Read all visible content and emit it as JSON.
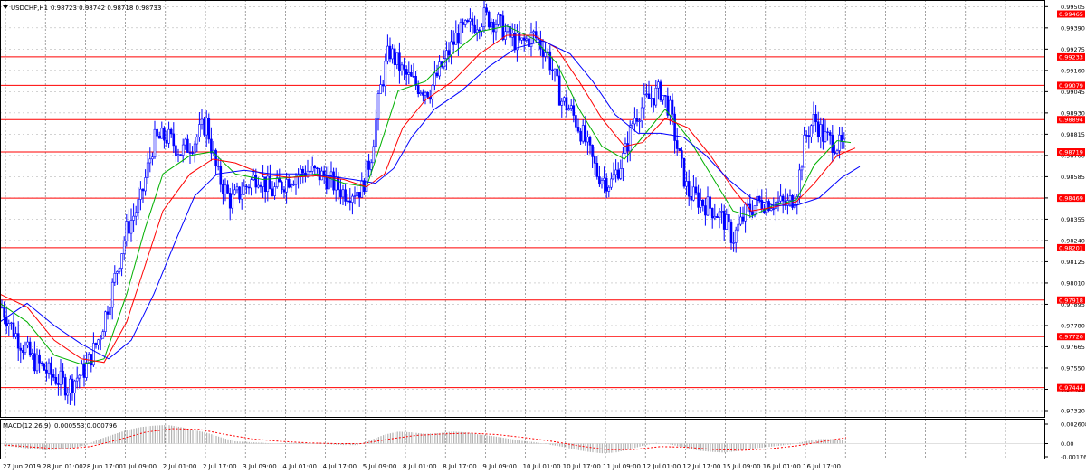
{
  "window": {
    "symbol_label": "USDCHF,H1",
    "ohlc_text": "0.98723 0.98742 0.98718 0.98733",
    "collapse_icon": "triangle-down-icon"
  },
  "macd_panel": {
    "label": "MACD(12,26,9)",
    "values_text": "0.000553 0.000796",
    "axis_ticks": [
      "0.002608",
      "0.00",
      "-0.001761"
    ],
    "ylim": [
      -0.001761,
      0.002608
    ]
  },
  "colors": {
    "candles": "#0000ff",
    "support_resistance_lines": "#ff0000",
    "ma_fast": "#00b000",
    "ma_mid": "#ff0000",
    "ma_slow": "#0000ff",
    "macd_histogram": "#b4b4b4",
    "macd_signal": "#ff0000",
    "level_tag_bg": "#ff0000"
  },
  "chart_data": {
    "type": "candlestick",
    "title": "",
    "ylim": [
      0.9732,
      0.9958
    ],
    "grid": true,
    "price_axis_ticks": [
      "0.99505",
      "0.99390",
      "0.99275",
      "0.99160",
      "0.99045",
      "0.98930",
      "0.98815",
      "0.98700",
      "0.98585",
      "0.98470",
      "0.98355",
      "0.98240",
      "0.98125",
      "0.98010",
      "0.97895",
      "0.97780",
      "0.97665",
      "0.97550",
      "0.97435",
      "0.97320"
    ],
    "time_axis_labels": [
      "27 Jun 2019",
      "28 Jun 01:00",
      "28 Jun 17:00",
      "1 Jul 09:00",
      "2 Jul 01:00",
      "2 Jul 17:00",
      "3 Jul 09:00",
      "4 Jul 01:00",
      "4 Jul 17:00",
      "5 Jul 09:00",
      "8 Jul 01:00",
      "8 Jul 17:00",
      "9 Jul 09:00",
      "10 Jul 01:00",
      "10 Jul 17:00",
      "11 Jul 09:00",
      "12 Jul 01:00",
      "12 Jul 17:00",
      "15 Jul 09:00",
      "16 Jul 01:00",
      "16 Jul 17:00"
    ],
    "horizontal_levels": [
      "0.99465",
      "0.99233",
      "0.99079",
      "0.98894",
      "0.98719",
      "0.98469",
      "0.98201",
      "0.97918",
      "0.97720",
      "0.97444"
    ],
    "price_path": [
      [
        0,
        0.979
      ],
      [
        15,
        0.9775
      ],
      [
        35,
        0.976
      ],
      [
        55,
        0.9752
      ],
      [
        75,
        0.9745
      ],
      [
        95,
        0.9755
      ],
      [
        110,
        0.9772
      ],
      [
        125,
        0.98
      ],
      [
        140,
        0.983
      ],
      [
        155,
        0.9845
      ],
      [
        170,
        0.9878
      ],
      [
        185,
        0.988
      ],
      [
        200,
        0.9872
      ],
      [
        215,
        0.9878
      ],
      [
        228,
        0.9888
      ],
      [
        240,
        0.986
      ],
      [
        255,
        0.9845
      ],
      [
        270,
        0.9852
      ],
      [
        285,
        0.986
      ],
      [
        300,
        0.985
      ],
      [
        320,
        0.9858
      ],
      [
        340,
        0.9862
      ],
      [
        360,
        0.9858
      ],
      [
        380,
        0.985
      ],
      [
        400,
        0.9852
      ],
      [
        410,
        0.987
      ],
      [
        420,
        0.9905
      ],
      [
        430,
        0.9927
      ],
      [
        445,
        0.9915
      ],
      [
        460,
        0.9908
      ],
      [
        475,
        0.9905
      ],
      [
        490,
        0.992
      ],
      [
        505,
        0.9935
      ],
      [
        520,
        0.994
      ],
      [
        535,
        0.9945
      ],
      [
        550,
        0.9942
      ],
      [
        560,
        0.9935
      ],
      [
        575,
        0.993
      ],
      [
        590,
        0.9935
      ],
      [
        605,
        0.9925
      ],
      [
        620,
        0.99
      ],
      [
        630,
        0.9895
      ],
      [
        645,
        0.988
      ],
      [
        660,
        0.986
      ],
      [
        675,
        0.9855
      ],
      [
        690,
        0.987
      ],
      [
        700,
        0.989
      ],
      [
        715,
        0.99
      ],
      [
        730,
        0.9905
      ],
      [
        740,
        0.9895
      ],
      [
        750,
        0.987
      ],
      [
        760,
        0.985
      ],
      [
        775,
        0.9845
      ],
      [
        790,
        0.984
      ],
      [
        800,
        0.9835
      ],
      [
        810,
        0.9825
      ],
      [
        825,
        0.984
      ],
      [
        840,
        0.9845
      ],
      [
        855,
        0.9845
      ],
      [
        870,
        0.9843
      ],
      [
        880,
        0.985
      ],
      [
        890,
        0.988
      ],
      [
        900,
        0.989
      ],
      [
        910,
        0.988
      ],
      [
        925,
        0.9876
      ],
      [
        935,
        0.9873
      ]
    ],
    "moving_averages": [
      {
        "name": "",
        "color": "#00b000",
        "points": [
          [
            0,
            0.979
          ],
          [
            30,
            0.978
          ],
          [
            60,
            0.9762
          ],
          [
            90,
            0.9757
          ],
          [
            115,
            0.976
          ],
          [
            140,
            0.9795
          ],
          [
            160,
            0.983
          ],
          [
            180,
            0.986
          ],
          [
            210,
            0.987
          ],
          [
            235,
            0.9872
          ],
          [
            260,
            0.986
          ],
          [
            290,
            0.9857
          ],
          [
            320,
            0.9858
          ],
          [
            350,
            0.986
          ],
          [
            380,
            0.9855
          ],
          [
            405,
            0.9853
          ],
          [
            420,
            0.9875
          ],
          [
            440,
            0.9905
          ],
          [
            470,
            0.991
          ],
          [
            500,
            0.9925
          ],
          [
            530,
            0.9937
          ],
          [
            560,
            0.994
          ],
          [
            590,
            0.9933
          ],
          [
            615,
            0.992
          ],
          [
            640,
            0.9895
          ],
          [
            665,
            0.9875
          ],
          [
            690,
            0.9868
          ],
          [
            710,
            0.988
          ],
          [
            735,
            0.9895
          ],
          [
            760,
            0.988
          ],
          [
            785,
            0.986
          ],
          [
            810,
            0.984
          ],
          [
            830,
            0.9837
          ],
          [
            855,
            0.9843
          ],
          [
            880,
            0.9846
          ],
          [
            900,
            0.9865
          ],
          [
            925,
            0.9878
          ],
          [
            940,
            0.9877
          ]
        ]
      },
      {
        "name": "",
        "color": "#ff0000",
        "points": [
          [
            0,
            0.9795
          ],
          [
            30,
            0.9788
          ],
          [
            60,
            0.977
          ],
          [
            90,
            0.976
          ],
          [
            115,
            0.9758
          ],
          [
            140,
            0.978
          ],
          [
            160,
            0.981
          ],
          [
            180,
            0.984
          ],
          [
            210,
            0.986
          ],
          [
            235,
            0.9868
          ],
          [
            260,
            0.9866
          ],
          [
            290,
            0.986
          ],
          [
            320,
            0.9858
          ],
          [
            350,
            0.9859
          ],
          [
            380,
            0.9857
          ],
          [
            405,
            0.9853
          ],
          [
            425,
            0.986
          ],
          [
            445,
            0.9885
          ],
          [
            470,
            0.99
          ],
          [
            500,
            0.991
          ],
          [
            530,
            0.9925
          ],
          [
            560,
            0.9935
          ],
          [
            590,
            0.9935
          ],
          [
            615,
            0.9928
          ],
          [
            640,
            0.991
          ],
          [
            665,
            0.989
          ],
          [
            690,
            0.9875
          ],
          [
            710,
            0.9877
          ],
          [
            735,
            0.989
          ],
          [
            760,
            0.9885
          ],
          [
            785,
            0.987
          ],
          [
            810,
            0.9852
          ],
          [
            830,
            0.984
          ],
          [
            855,
            0.9842
          ],
          [
            880,
            0.9845
          ],
          [
            900,
            0.9855
          ],
          [
            925,
            0.987
          ],
          [
            945,
            0.9874
          ]
        ]
      },
      {
        "name": "",
        "color": "#0000ff",
        "points": [
          [
            0,
            0.978
          ],
          [
            30,
            0.979
          ],
          [
            60,
            0.9778
          ],
          [
            90,
            0.9768
          ],
          [
            120,
            0.976
          ],
          [
            145,
            0.977
          ],
          [
            170,
            0.9795
          ],
          [
            195,
            0.9825
          ],
          [
            215,
            0.9848
          ],
          [
            240,
            0.986
          ],
          [
            270,
            0.9862
          ],
          [
            300,
            0.986
          ],
          [
            330,
            0.986
          ],
          [
            360,
            0.9859
          ],
          [
            390,
            0.9857
          ],
          [
            415,
            0.9855
          ],
          [
            435,
            0.9863
          ],
          [
            455,
            0.988
          ],
          [
            480,
            0.9895
          ],
          [
            510,
            0.9905
          ],
          [
            540,
            0.9918
          ],
          [
            570,
            0.9928
          ],
          [
            600,
            0.9932
          ],
          [
            630,
            0.9925
          ],
          [
            655,
            0.991
          ],
          [
            680,
            0.9892
          ],
          [
            705,
            0.9882
          ],
          [
            730,
            0.9882
          ],
          [
            755,
            0.988
          ],
          [
            780,
            0.987
          ],
          [
            805,
            0.9857
          ],
          [
            830,
            0.9847
          ],
          [
            855,
            0.9843
          ],
          [
            880,
            0.9843
          ],
          [
            905,
            0.9847
          ],
          [
            930,
            0.9858
          ],
          [
            950,
            0.9864
          ]
        ]
      }
    ],
    "macd_histogram": [
      [
        5,
        -0.0003
      ],
      [
        20,
        -0.0005
      ],
      [
        35,
        -0.0007
      ],
      [
        50,
        -0.0009
      ],
      [
        65,
        -0.0008
      ],
      [
        80,
        -0.0006
      ],
      [
        95,
        -0.0002
      ],
      [
        110,
        0.0006
      ],
      [
        125,
        0.0012
      ],
      [
        140,
        0.0018
      ],
      [
        155,
        0.0022
      ],
      [
        170,
        0.0024
      ],
      [
        185,
        0.0025
      ],
      [
        200,
        0.0022
      ],
      [
        215,
        0.0018
      ],
      [
        230,
        0.0014
      ],
      [
        245,
        0.0008
      ],
      [
        260,
        0.0003
      ],
      [
        275,
        0.0002
      ],
      [
        290,
        0.0001
      ],
      [
        305,
        0.0
      ],
      [
        320,
        0.0001
      ],
      [
        335,
        0.0001
      ],
      [
        350,
        0.0
      ],
      [
        365,
        -0.0001
      ],
      [
        380,
        -0.0002
      ],
      [
        395,
        -0.0002
      ],
      [
        410,
        0.0005
      ],
      [
        425,
        0.0012
      ],
      [
        440,
        0.0016
      ],
      [
        455,
        0.0015
      ],
      [
        470,
        0.0013
      ],
      [
        485,
        0.0014
      ],
      [
        500,
        0.0016
      ],
      [
        515,
        0.0015
      ],
      [
        530,
        0.0012
      ],
      [
        545,
        0.001
      ],
      [
        560,
        0.0007
      ],
      [
        575,
        0.0004
      ],
      [
        590,
        0.0002
      ],
      [
        605,
        -0.0001
      ],
      [
        620,
        -0.0004
      ],
      [
        635,
        -0.0008
      ],
      [
        650,
        -0.0011
      ],
      [
        665,
        -0.0013
      ],
      [
        680,
        -0.0012
      ],
      [
        695,
        -0.0008
      ],
      [
        710,
        -0.0003
      ],
      [
        725,
        0.0001
      ],
      [
        740,
        -0.0001
      ],
      [
        755,
        -0.0005
      ],
      [
        770,
        -0.0009
      ],
      [
        785,
        -0.0011
      ],
      [
        800,
        -0.0012
      ],
      [
        815,
        -0.001
      ],
      [
        830,
        -0.0007
      ],
      [
        845,
        -0.0005
      ],
      [
        860,
        -0.0003
      ],
      [
        875,
        -0.0001
      ],
      [
        890,
        0.0003
      ],
      [
        905,
        0.0006
      ],
      [
        920,
        0.0006
      ],
      [
        932,
        0.0005
      ]
    ],
    "macd_signal": [
      [
        5,
        -0.0002
      ],
      [
        40,
        -0.0005
      ],
      [
        70,
        -0.0007
      ],
      [
        100,
        -0.0004
      ],
      [
        130,
        0.0005
      ],
      [
        160,
        0.0015
      ],
      [
        190,
        0.002
      ],
      [
        220,
        0.0019
      ],
      [
        250,
        0.0012
      ],
      [
        280,
        0.0006
      ],
      [
        310,
        0.0003
      ],
      [
        340,
        0.0001
      ],
      [
        370,
        0.0
      ],
      [
        400,
        0.0
      ],
      [
        430,
        0.0006
      ],
      [
        460,
        0.0011
      ],
      [
        490,
        0.0013
      ],
      [
        520,
        0.0014
      ],
      [
        550,
        0.0012
      ],
      [
        580,
        0.0008
      ],
      [
        610,
        0.0003
      ],
      [
        640,
        -0.0003
      ],
      [
        670,
        -0.0008
      ],
      [
        700,
        -0.0008
      ],
      [
        730,
        -0.0004
      ],
      [
        760,
        -0.0005
      ],
      [
        790,
        -0.0008
      ],
      [
        820,
        -0.0009
      ],
      [
        850,
        -0.0007
      ],
      [
        880,
        -0.0003
      ],
      [
        910,
        0.0003
      ],
      [
        935,
        0.0008
      ]
    ]
  }
}
